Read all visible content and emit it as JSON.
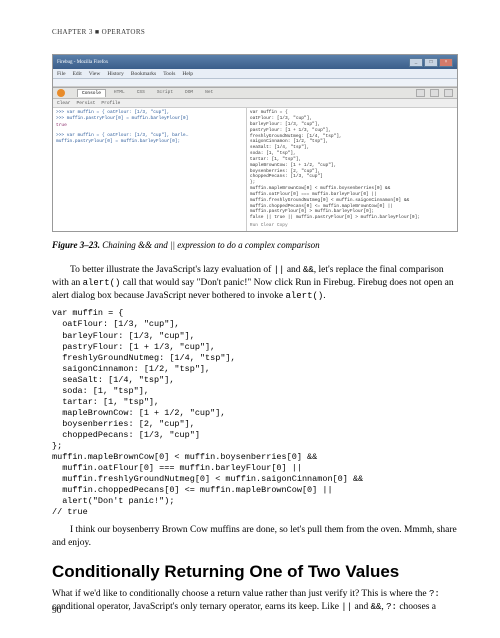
{
  "header": "CHAPTER 3 ■ OPERATORS",
  "screenshot": {
    "titlebar": {
      "title": "Firebug - Mozilla Firefox"
    },
    "menubar": [
      "File",
      "Edit",
      "View",
      "History",
      "Bookmarks",
      "Tools",
      "Help"
    ],
    "firebug": {
      "tabs": [
        "Console",
        "HTML",
        "CSS",
        "Script",
        "DOM",
        "Net"
      ],
      "subtabs": [
        "Clear",
        "Persist",
        "Profile"
      ],
      "left": [
        ">>> var muffin = {  oatFlour: [1/3, \"cup\"],",
        ">>> muffin.pastryFlour[0] = muffin.barleyFlour[0]",
        "true",
        "",
        ">>> var muffin = {  oatFlour: [1/3, \"cup\"], barle…",
        "muffin.pastryFlour[0] = muffin.barleyFlour[0];"
      ],
      "right": [
        "var muffin = {",
        "  oatFlour: [1/3, \"cup\"],",
        "  barleyFlour: [1/3, \"cup\"],",
        "  pastryFlour: [1 + 1/3, \"cup\"],",
        "  freshlyGroundNutmeg: [1/4, \"tsp\"],",
        "  saigonCinnamon: [1/2, \"tsp\"],",
        "  seaSalt: [1/4, \"tsp\"],",
        "  soda: [1, \"tsp\"],",
        "  tartar: [1, \"tsp\"],",
        "  mapleBrownCow: [1 + 1/2, \"cup\"],",
        "  boysenberries: [2, \"cup\"],",
        "  choppedPecans: [1/3, \"cup\"]",
        "};",
        "muffin.mapleBrownCow[0] < muffin.boysenberries[0] &&",
        "  muffin.oatFlour[0] === muffin.barleyFlour[0] ||",
        "  muffin.freshlyGroundNutmeg[0] < muffin.saigonCinnamon[0] &&",
        "  muffin.choppedPecans[0] <= muffin.mapleBrownCow[0] ||",
        "  muffin.pastryFlour[0] > muffin.barleyFlour[0];",
        "false || true || muffin.pastryFlour[0] > muffin.barleyFlour[0];"
      ],
      "footer": "Run   Clear   Copy"
    }
  },
  "caption": {
    "label": "Figure 3–23.",
    "text": " Chaining && and || expression to do a complex comparison"
  },
  "para1_a": "To better illustrate the JavaScript's lazy evaluation of ",
  "para1_b": " and ",
  "para1_c": ", let's replace the final comparison with an ",
  "para1_d": " call that would say \"Don't panic!\" Now click Run in Firebug. Firebug does not open an alert dialog box because JavaScript never bothered to invoke ",
  "para1_e": ".",
  "inline": {
    "or": "||",
    "and": "&&",
    "alert": "alert()"
  },
  "code1": "var muffin = {\n  oatFlour: [1/3, \"cup\"],\n  barleyFlour: [1/3, \"cup\"],\n  pastryFlour: [1 + 1/3, \"cup\"],\n  freshlyGroundNutmeg: [1/4, \"tsp\"],\n  saigonCinnamon: [1/2, \"tsp\"],\n  seaSalt: [1/4, \"tsp\"],\n  soda: [1, \"tsp\"],\n  tartar: [1, \"tsp\"],\n  mapleBrownCow: [1 + 1/2, \"cup\"],\n  boysenberries: [2, \"cup\"],\n  choppedPecans: [1/3, \"cup\"]\n};\nmuffin.mapleBrownCow[0] < muffin.boysenberries[0] &&\n  muffin.oatFlour[0] === muffin.barleyFlour[0] ||\n  muffin.freshlyGroundNutmeg[0] < muffin.saigonCinnamon[0] &&\n  muffin.choppedPecans[0] <= muffin.mapleBrownCow[0] ||\n  alert(\"Don't panic!\");\n// true",
  "para2": "I think our boysenberry Brown Cow muffins are done, so let's pull them from the oven. Mmmh, share and enjoy.",
  "section_heading": "Conditionally Returning One of Two Values",
  "para3_a": "What if we'd like to conditionally choose a return value rather than just verify it? This is where the ",
  "para3_b": " conditional operator, JavaScript's only ternary operator, earns its keep. Like ",
  "para3_c": " and ",
  "para3_d": ", ",
  "para3_e": " chooses a",
  "inline2": {
    "ternary": "?:",
    "or": "||",
    "and": "&&"
  },
  "page_number": "90"
}
